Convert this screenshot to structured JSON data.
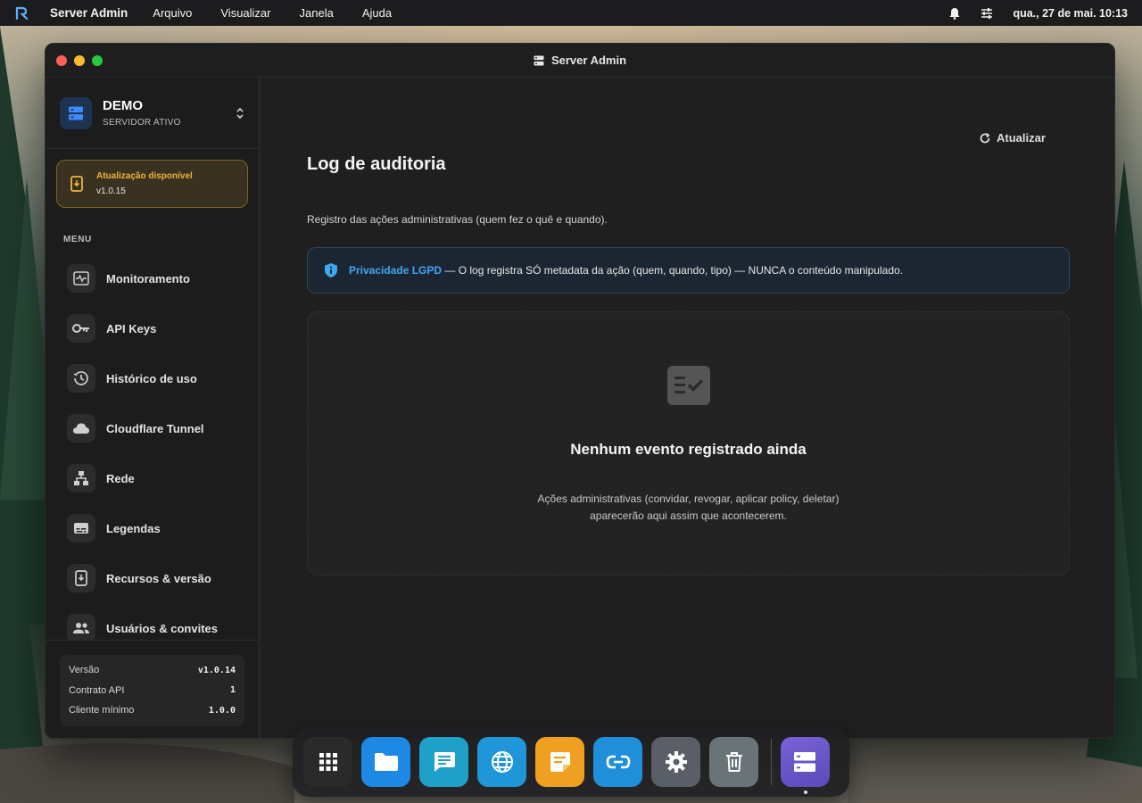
{
  "menubar": {
    "app_name": "Server Admin",
    "menus": [
      "Arquivo",
      "Visualizar",
      "Janela",
      "Ajuda"
    ],
    "clock": "qua., 27 de mai. 10:13"
  },
  "window": {
    "title": "Server Admin"
  },
  "sidebar": {
    "server_name": "DEMO",
    "server_status": "SERVIDOR ATIVO",
    "update": {
      "title": "Atualização disponível",
      "version": "v1.0.15"
    },
    "menu_label": "MENU",
    "items": [
      {
        "label": "Monitoramento",
        "icon": "monitor-heartbeat-icon"
      },
      {
        "label": "API Keys",
        "icon": "key-icon"
      },
      {
        "label": "Histórico de uso",
        "icon": "history-icon"
      },
      {
        "label": "Cloudflare Tunnel",
        "icon": "cloud-icon"
      },
      {
        "label": "Rede",
        "icon": "network-icon"
      },
      {
        "label": "Legendas",
        "icon": "subtitles-icon"
      },
      {
        "label": "Recursos & versão",
        "icon": "update-device-icon"
      },
      {
        "label": "Usuários & convites",
        "icon": "users-icon"
      }
    ],
    "version_info": [
      {
        "label": "Versão",
        "value": "v1.0.14"
      },
      {
        "label": "Contrato API",
        "value": "1"
      },
      {
        "label": "Cliente mínimo",
        "value": "1.0.0"
      }
    ]
  },
  "main": {
    "refresh_label": "Atualizar",
    "title": "Log de auditoria",
    "description": "Registro das ações administrativas (quem fez o quê e quando).",
    "notice": {
      "strong": "Privacidade LGPD",
      "text": " — O log registra SÓ metadata da ação (quem, quando, tipo) — NUNCA o conteúdo manipulado."
    },
    "empty": {
      "title": "Nenhum evento registrado ainda",
      "line1": "Ações administrativas (convidar, revogar, aplicar policy, deletar)",
      "line2": "aparecerão aqui assim que acontecerem."
    }
  },
  "dock": {
    "apps": [
      {
        "icon": "grid-icon",
        "color": "#2a2a2a"
      },
      {
        "icon": "folder-icon",
        "color": "#1e88e5"
      },
      {
        "icon": "chat-icon",
        "color": "#1ea0c8"
      },
      {
        "icon": "globe-icon",
        "color": "#1e96d8"
      },
      {
        "icon": "notes-icon",
        "color": "#f0a020"
      },
      {
        "icon": "link-icon",
        "color": "#1e8fd8"
      },
      {
        "icon": "settings-icon",
        "color": "#5a5e66"
      },
      {
        "icon": "trash-icon",
        "color": "#6a7378"
      }
    ],
    "active_app": {
      "icon": "server-icon",
      "color": "#6a5ac8"
    }
  },
  "colors": {
    "accent_blue": "#3ea8f2",
    "update_orange": "#f2b43a",
    "window_bg": "#1f1f1f"
  }
}
